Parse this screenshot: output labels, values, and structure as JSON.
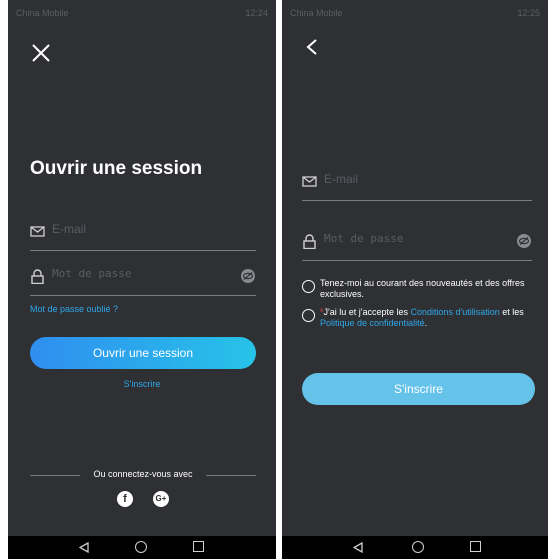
{
  "login_screen": {
    "status_bar": {
      "carrier": "China Mobile",
      "time": "12:24"
    },
    "title": "Ouvrir une session",
    "email_placeholder": "E-mail",
    "password_placeholder": "Mot de passe",
    "forgot_password": "Mot de passe oublié ?",
    "submit_label": "Ouvrir une session",
    "register_link": "S'inscrire",
    "social_divider": "Ou connectez-vous avec",
    "social": [
      {
        "name": "facebook",
        "glyph": "f"
      },
      {
        "name": "google-plus",
        "glyph": "G+"
      }
    ]
  },
  "signup_screen": {
    "status_bar": {
      "carrier": "China Mobile",
      "time": "12:25"
    },
    "email_placeholder": "E-mail",
    "password_placeholder": "Mot de passe",
    "newsletter_text": "Tenez-moi au courant des nouveautés et des offres exclusives.",
    "terms": {
      "required_mark": "*",
      "prefix": "J'ai lu et j'accepte les ",
      "conditions_link": "Conditions d'utilisation",
      "middle": " et les ",
      "privacy_link": "Politique de confidentialité",
      "suffix": "."
    },
    "submit_label": "S'inscrire"
  },
  "colors": {
    "background": "#2f3034",
    "accent": "#2ea8e8",
    "button_gradient_start": "#2f8ef0",
    "button_gradient_end": "#27c3e8",
    "disabled_button": "#65c3ea",
    "required": "#e0414b"
  }
}
